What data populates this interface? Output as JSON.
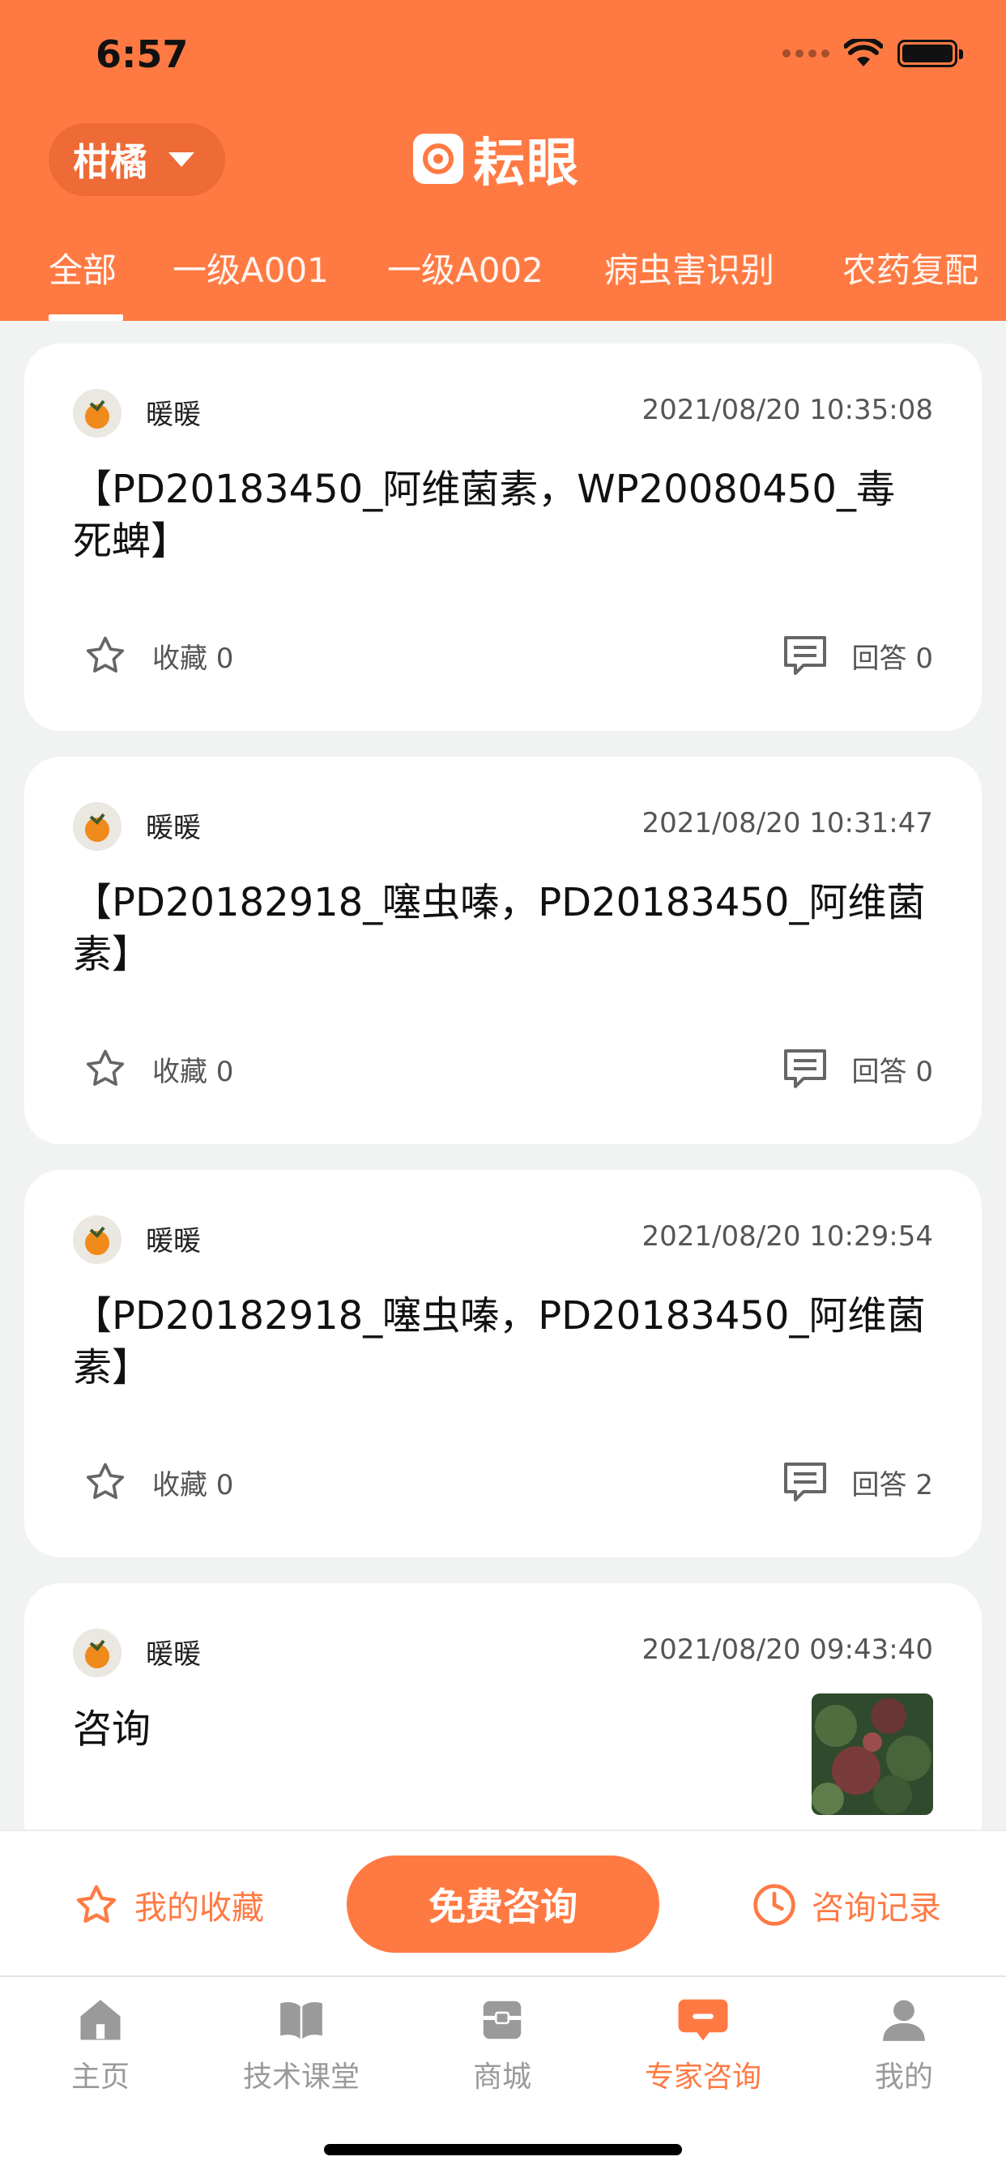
{
  "status_bar": {
    "time": "6:57"
  },
  "header": {
    "crop": "柑橘",
    "logo_text": "耘眼",
    "tabs": [
      "全部",
      "一级A001",
      "一级A002",
      "病虫害识别",
      "农药复配"
    ],
    "active_tab": 0
  },
  "posts": [
    {
      "author": "暖暖",
      "date": "2021/08/20 10:35:08",
      "title": "【PD20183450_阿维菌素，WP20080450_毒死蜱】",
      "fav_label": "收藏 0",
      "reply_label": "回答 0"
    },
    {
      "author": "暖暖",
      "date": "2021/08/20 10:31:47",
      "title": "【PD20182918_噻虫嗪，PD20183450_阿维菌素】",
      "fav_label": "收藏 0",
      "reply_label": "回答 0"
    },
    {
      "author": "暖暖",
      "date": "2021/08/20 10:29:54",
      "title": "【PD20182918_噻虫嗪，PD20183450_阿维菌素】",
      "fav_label": "收藏 0",
      "reply_label": "回答 2"
    },
    {
      "author": "暖暖",
      "date": "2021/08/20 09:43:40",
      "title": "咨询"
    }
  ],
  "actions": {
    "my_favorites": "我的收藏",
    "free_consult": "免费咨询",
    "history": "咨询记录"
  },
  "nav": {
    "items": [
      "主页",
      "技术课堂",
      "商城",
      "专家咨询",
      "我的"
    ],
    "active": 3
  },
  "colors": {
    "accent": "#ff7a43",
    "inactive": "#9a9a9a"
  }
}
